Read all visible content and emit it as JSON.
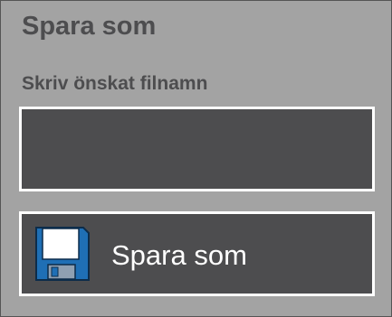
{
  "dialog": {
    "title": "Spara som",
    "filename_label": "Skriv önskat filnamn",
    "filename_value": "",
    "save_button_label": "Spara som",
    "save_button_icon": "floppy-disk-icon"
  },
  "colors": {
    "background": "#a3a3a3",
    "panel": "#4d4d4f",
    "text_dark": "#4d4d4f",
    "text_light": "#ffffff",
    "floppy_blue": "#1f6fb5"
  }
}
